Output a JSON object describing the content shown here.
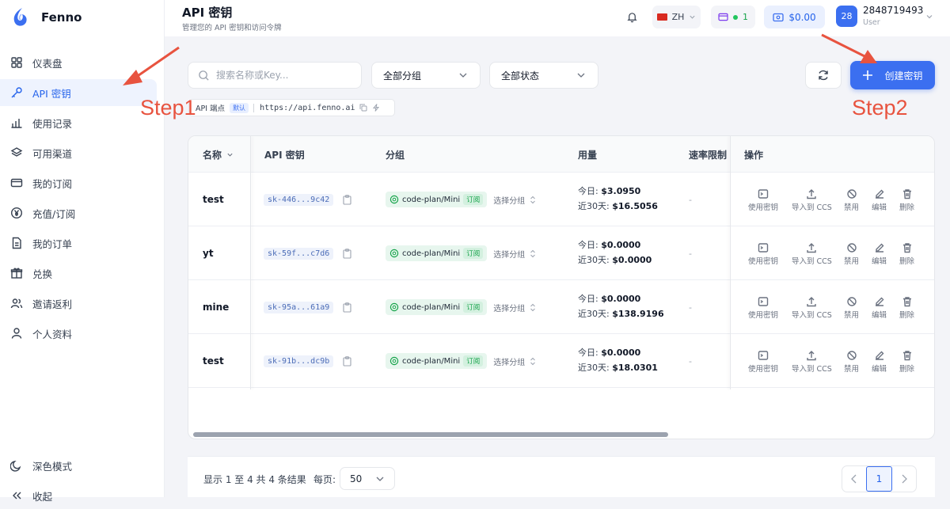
{
  "app": {
    "name": "Fenno"
  },
  "sidebar": {
    "items": [
      {
        "label": "仪表盘",
        "icon": "dashboard-icon"
      },
      {
        "label": "API 密钥",
        "icon": "key-icon"
      },
      {
        "label": "使用记录",
        "icon": "bar-chart-icon"
      },
      {
        "label": "可用渠道",
        "icon": "layers-icon"
      },
      {
        "label": "我的订阅",
        "icon": "card-icon"
      },
      {
        "label": "充值/订阅",
        "icon": "yen-icon"
      },
      {
        "label": "我的订单",
        "icon": "document-icon"
      },
      {
        "label": "兑换",
        "icon": "gift-icon"
      },
      {
        "label": "邀请返利",
        "icon": "users-icon"
      },
      {
        "label": "个人资料",
        "icon": "user-icon"
      }
    ],
    "active_index": 1,
    "dark_mode_label": "深色模式",
    "collapse_label": "收起"
  },
  "header": {
    "title": "API 密钥",
    "subtitle": "管理您的 API 密钥和访问令牌",
    "language": "ZH",
    "subscription_count": "1",
    "balance": "$0.00",
    "user_name": "2848719493",
    "user_role": "User",
    "avatar_text": "28"
  },
  "toolbar": {
    "search_placeholder": "搜索名称或Key...",
    "group_filter": "全部分组",
    "status_filter": "全部状态",
    "create_label": "创建密钥"
  },
  "endpoint": {
    "label": "API 端点",
    "badge": "默认",
    "url": "https://api.fenno.ai"
  },
  "annotations": {
    "step1": "Step1",
    "step2": "Step2"
  },
  "table": {
    "headers": {
      "name": "名称",
      "key": "API 密钥",
      "group": "分组",
      "usage": "用量",
      "rate": "速率限制",
      "actions": "操作"
    },
    "today_label": "今日: ",
    "month_label": "近30天: ",
    "group_badge": "订阅",
    "select_group": "选择分组",
    "rate_empty": "-",
    "action_labels": [
      "使用密钥",
      "导入到 CCS",
      "禁用",
      "编辑",
      "删除"
    ],
    "rows": [
      {
        "name": "test",
        "key": "sk-446...9c42",
        "group": "code-plan/Mini",
        "today": "$3.0950",
        "month": "$16.5056"
      },
      {
        "name": "yt",
        "key": "sk-59f...c7d6",
        "group": "code-plan/Mini",
        "today": "$0.0000",
        "month": "$0.0000"
      },
      {
        "name": "mine",
        "key": "sk-95a...61a9",
        "group": "code-plan/Mini",
        "today": "$0.0000",
        "month": "$138.9196"
      },
      {
        "name": "test",
        "key": "sk-91b...dc9b",
        "group": "code-plan/Mini",
        "today": "$0.0000",
        "month": "$18.0301"
      }
    ]
  },
  "footer": {
    "summary": "显示 1 至 4 共 4 条结果",
    "per_page_label": "每页:",
    "per_page": "50",
    "current_page": "1"
  },
  "colors": {
    "accent": "#3b6ff0",
    "annotation": "#e8533f",
    "success": "#16a34a"
  }
}
